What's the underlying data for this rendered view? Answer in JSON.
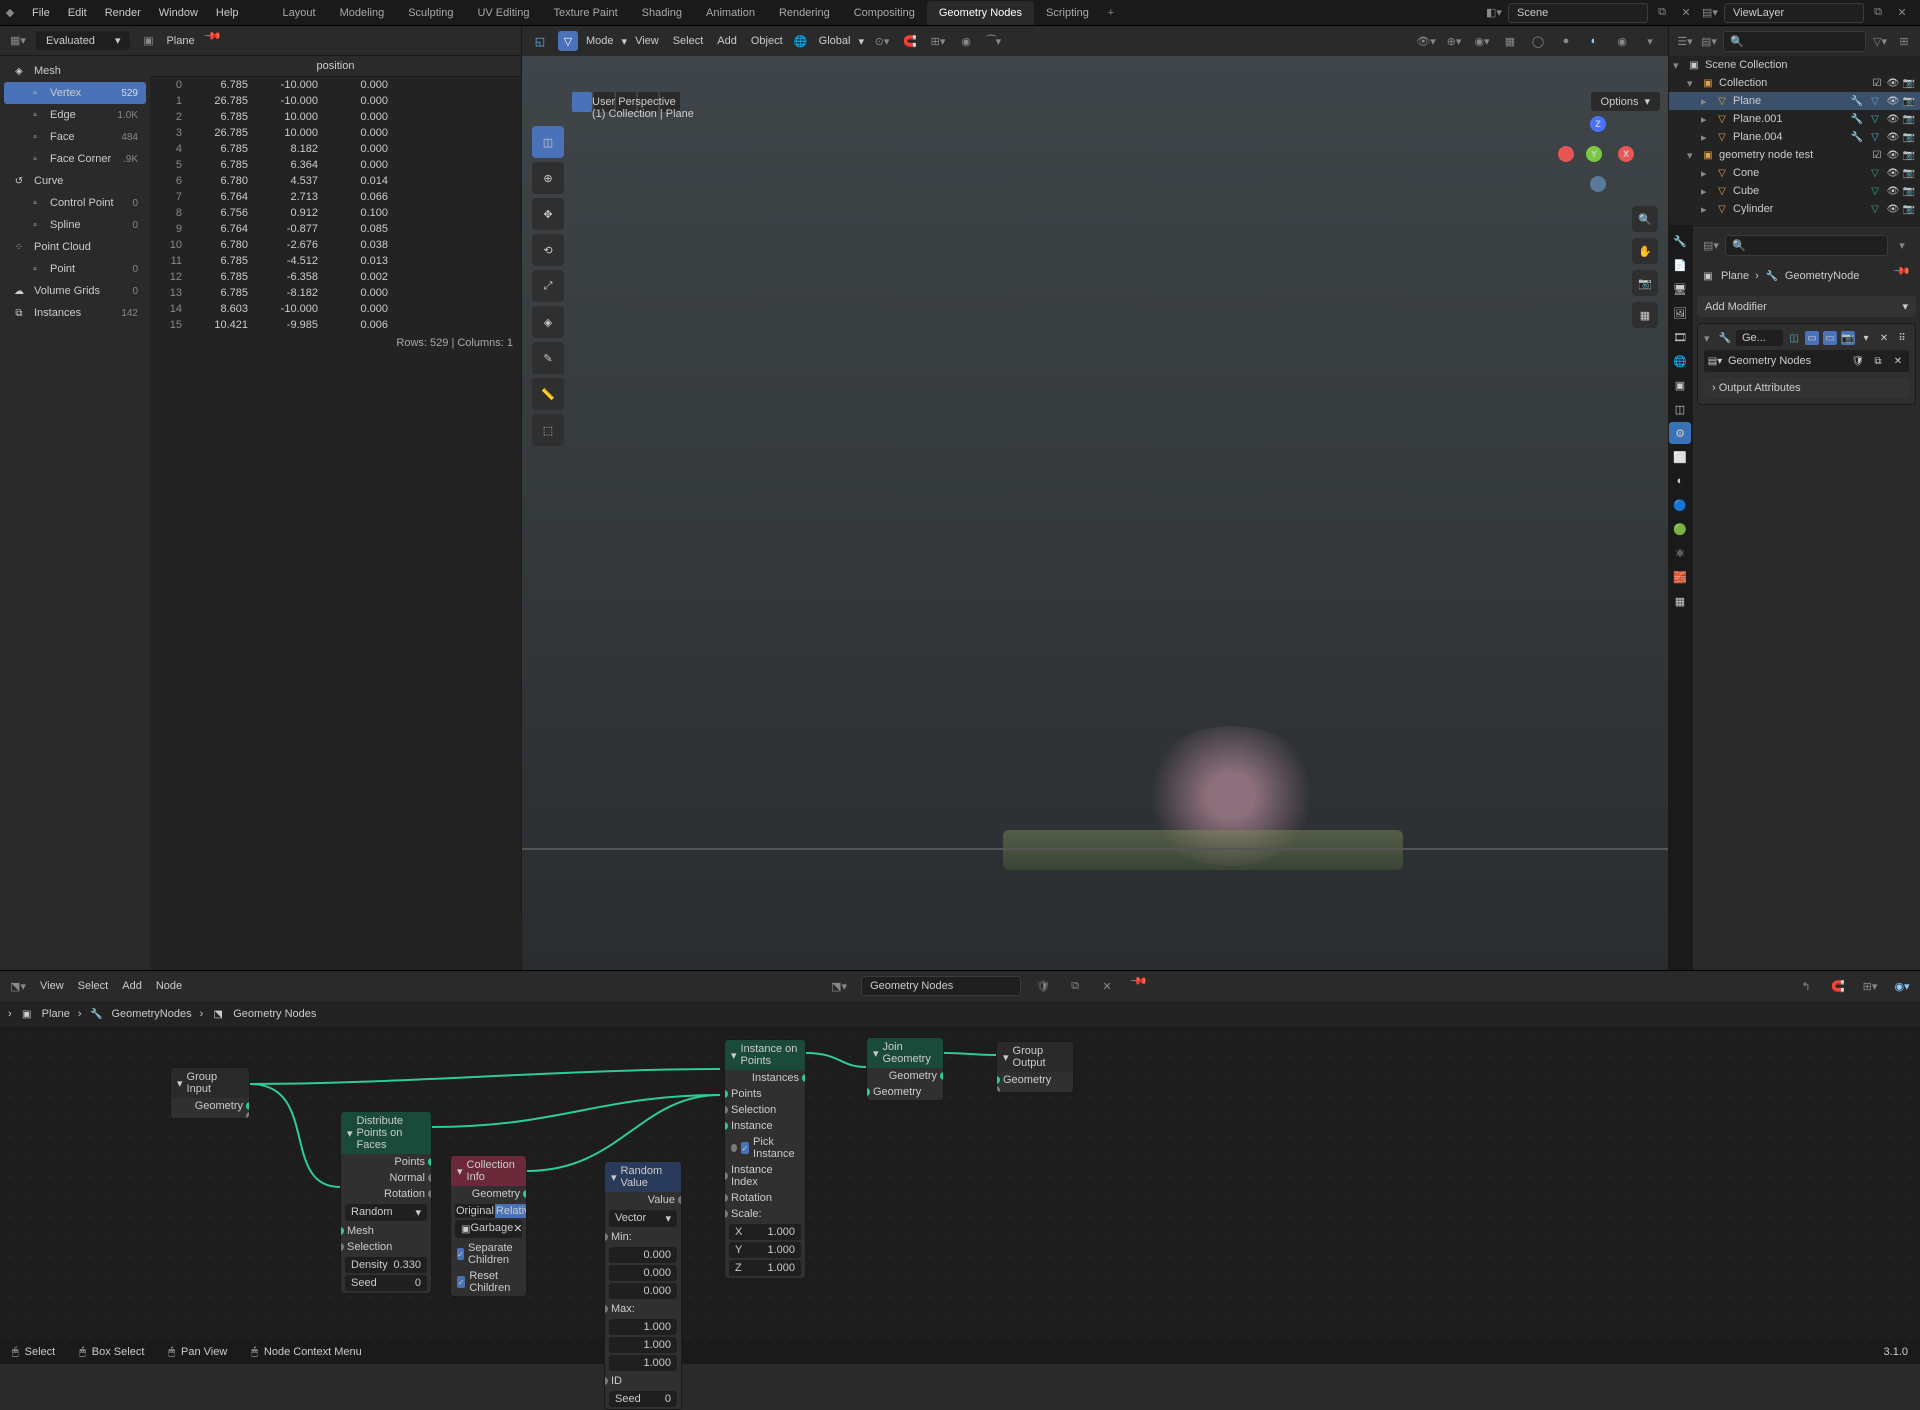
{
  "topmenu": [
    "File",
    "Edit",
    "Render",
    "Window",
    "Help"
  ],
  "tabs": [
    "Layout",
    "Modeling",
    "Sculpting",
    "UV Editing",
    "Texture Paint",
    "Shading",
    "Animation",
    "Rendering",
    "Compositing",
    "Geometry Nodes",
    "Scripting"
  ],
  "active_tab": "Geometry Nodes",
  "scene_name": "Scene",
  "viewlayer_name": "ViewLayer",
  "spreadsheet": {
    "mode": "Evaluated",
    "object": "Plane",
    "sidebar": [
      {
        "label": "Mesh",
        "count": "",
        "indent": 0,
        "icon": "◈"
      },
      {
        "label": "Vertex",
        "count": "529",
        "indent": 1,
        "active": true,
        "icon": "▫"
      },
      {
        "label": "Edge",
        "count": "1.0K",
        "indent": 1,
        "icon": "▫"
      },
      {
        "label": "Face",
        "count": "484",
        "indent": 1,
        "icon": "▫"
      },
      {
        "label": "Face Corner",
        "count": ".9K",
        "indent": 1,
        "icon": "▫"
      },
      {
        "label": "Curve",
        "count": "",
        "indent": 0,
        "icon": "↺"
      },
      {
        "label": "Control Point",
        "count": "0",
        "indent": 1,
        "icon": "▫"
      },
      {
        "label": "Spline",
        "count": "0",
        "indent": 1,
        "icon": "▫"
      },
      {
        "label": "Point Cloud",
        "count": "",
        "indent": 0,
        "icon": "⁘"
      },
      {
        "label": "Point",
        "count": "0",
        "indent": 1,
        "icon": "▫"
      },
      {
        "label": "Volume Grids",
        "count": "0",
        "indent": 0,
        "icon": "☁"
      },
      {
        "label": "Instances",
        "count": "142",
        "indent": 0,
        "icon": "⧉"
      }
    ],
    "column": "position",
    "rows": [
      [
        0,
        "6.785",
        "-10.000",
        "0.000"
      ],
      [
        1,
        "26.785",
        "-10.000",
        "0.000"
      ],
      [
        2,
        "6.785",
        "10.000",
        "0.000"
      ],
      [
        3,
        "26.785",
        "10.000",
        "0.000"
      ],
      [
        4,
        "6.785",
        "8.182",
        "0.000"
      ],
      [
        5,
        "6.785",
        "6.364",
        "0.000"
      ],
      [
        6,
        "6.780",
        "4.537",
        "0.014"
      ],
      [
        7,
        "6.764",
        "2.713",
        "0.066"
      ],
      [
        8,
        "6.756",
        "0.912",
        "0.100"
      ],
      [
        9,
        "6.764",
        "-0.877",
        "0.085"
      ],
      [
        10,
        "6.780",
        "-2.676",
        "0.038"
      ],
      [
        11,
        "6.785",
        "-4.512",
        "0.013"
      ],
      [
        12,
        "6.785",
        "-6.358",
        "0.002"
      ],
      [
        13,
        "6.785",
        "-8.182",
        "0.000"
      ],
      [
        14,
        "8.603",
        "-10.000",
        "0.000"
      ],
      [
        15,
        "10.421",
        "-9.985",
        "0.006"
      ]
    ],
    "footer": "Rows: 529   |   Columns: 1"
  },
  "viewport": {
    "menu": [
      "View",
      "Select",
      "Add",
      "Object"
    ],
    "mode_prefix": "Mode",
    "orientation": "Global",
    "text1": "User Perspective",
    "text2": "(1) Collection | Plane",
    "options": "Options"
  },
  "outliner": {
    "root": "Scene Collection",
    "items": [
      {
        "name": "Collection",
        "indent": 1,
        "type": "collection",
        "open": true,
        "excl": true
      },
      {
        "name": "Plane",
        "indent": 2,
        "type": "mesh",
        "selected": true,
        "mod": true
      },
      {
        "name": "Plane.001",
        "indent": 2,
        "type": "mesh",
        "mod": true
      },
      {
        "name": "Plane.004",
        "indent": 2,
        "type": "mesh",
        "mod": true
      },
      {
        "name": "geometry node test",
        "indent": 1,
        "type": "collection",
        "open": true,
        "excl": true
      },
      {
        "name": "Cone",
        "indent": 2,
        "type": "mesh"
      },
      {
        "name": "Cube",
        "indent": 2,
        "type": "mesh"
      },
      {
        "name": "Cylinder",
        "indent": 2,
        "type": "mesh"
      }
    ]
  },
  "properties": {
    "breadcrumb_obj": "Plane",
    "breadcrumb_mod": "GeometryNode",
    "add_modifier": "Add Modifier",
    "mod_name": "Ge...",
    "node_group": "Geometry Nodes",
    "output_attrs": "Output Attributes"
  },
  "node_editor": {
    "menu": [
      "View",
      "Select",
      "Add",
      "Node"
    ],
    "tree_name": "Geometry Nodes",
    "breadcrumb": [
      "Plane",
      "GeometryNodes",
      "Geometry Nodes"
    ],
    "nodes": {
      "group_input": {
        "title": "Group Input",
        "outputs": [
          "Geometry"
        ]
      },
      "distribute": {
        "title": "Distribute Points on Faces",
        "outputs": [
          "Points",
          "Normal",
          "Rotation"
        ],
        "mode": "Random",
        "inputs": [
          "Mesh",
          "Selection"
        ],
        "density_label": "Density",
        "density": "0.330",
        "seed_label": "Seed",
        "seed": "0"
      },
      "collection_info": {
        "title": "Collection Info",
        "output": "Geometry",
        "toggle_original": "Original",
        "toggle_relative": "Relative",
        "collection": "Garbage",
        "sep_children": "Separate Children",
        "reset_children": "Reset Children"
      },
      "random": {
        "title": "Random Value",
        "output": "Value",
        "type": "Vector",
        "min_label": "Min:",
        "min": [
          "0.000",
          "0.000",
          "0.000"
        ],
        "max_label": "Max:",
        "max": [
          "1.000",
          "1.000",
          "1.000"
        ],
        "id_label": "ID",
        "seed_label": "Seed",
        "seed": "0"
      },
      "instance": {
        "title": "Instance on Points",
        "output": "Instances",
        "inputs": [
          "Points",
          "Selection",
          "Instance"
        ],
        "pick": "Pick Instance",
        "instance_index": "Instance Index",
        "rotation": "Rotation",
        "scale_label": "Scale:",
        "scale": [
          [
            "X",
            "1.000"
          ],
          [
            "Y",
            "1.000"
          ],
          [
            "Z",
            "1.000"
          ]
        ]
      },
      "join": {
        "title": "Join Geometry",
        "output": "Geometry",
        "input": "Geometry"
      },
      "group_output": {
        "title": "Group Output",
        "input": "Geometry"
      }
    }
  },
  "status": {
    "select": "Select",
    "box": "Box Select",
    "pan": "Pan View",
    "context": "Node Context Menu",
    "version": "3.1.0"
  }
}
